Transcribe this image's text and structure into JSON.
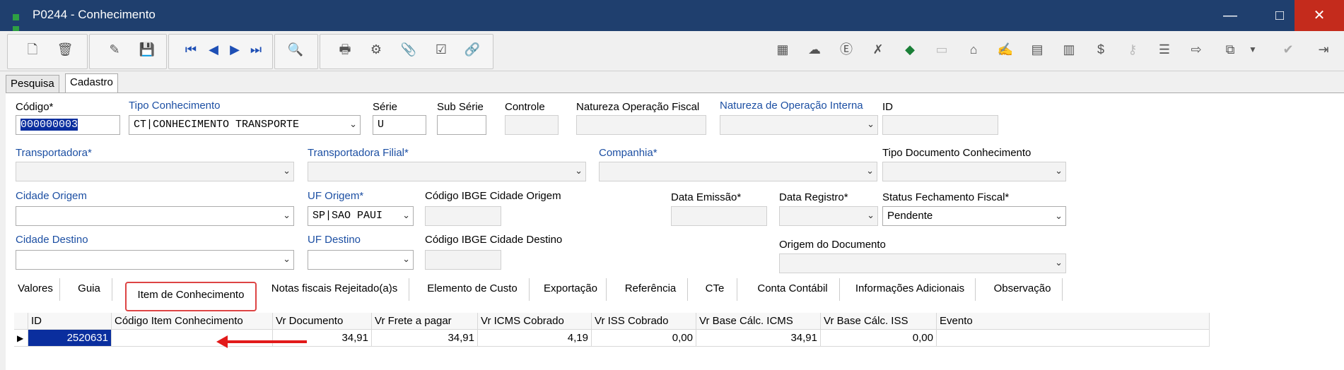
{
  "window": {
    "title": "P0244 - Conhecimento",
    "min": "—",
    "max": "□",
    "close": "✕"
  },
  "tabs_top": [
    "Pesquisa",
    "Cadastro"
  ],
  "form": {
    "codigo_label": "Código*",
    "codigo_value": "000000003",
    "tipo_label": "Tipo Conhecimento",
    "tipo_value": "CT|CONHECIMENTO TRANSPORTE",
    "serie_label": "Série",
    "serie_value": "U",
    "subserie_label": "Sub Série",
    "controle_label": "Controle",
    "nat_fiscal_label": "Natureza Operação Fiscal",
    "nat_interna_label": "Natureza de Operação Interna",
    "id_label": "ID",
    "transportadora_label": "Transportadora*",
    "transp_filial_label": "Transportadora Filial*",
    "companhia_label": "Companhia*",
    "tipo_doc_label": "Tipo Documento Conhecimento",
    "cidade_origem_label": "Cidade Origem",
    "uf_origem_label": "UF Origem*",
    "uf_origem_value": "SP|SAO PAUI",
    "ibge_origem_label": "Código IBGE Cidade Origem",
    "data_emissao_label": "Data Emissão*",
    "data_registro_label": "Data Registro*",
    "status_label": "Status Fechamento Fiscal*",
    "status_value": "Pendente",
    "cidade_destino_label": "Cidade Destino",
    "uf_destino_label": "UF Destino",
    "ibge_destino_label": "Código IBGE Cidade Destino",
    "origem_doc_label": "Origem do Documento"
  },
  "content_tabs": [
    "Valores",
    "Guia",
    "Item de Conhecimento",
    "Notas fiscais Rejeitado(a)s",
    "Elemento de Custo",
    "Exportação",
    "Referência",
    "CTe",
    "Conta Contábil",
    "Informações Adicionais",
    "Observação"
  ],
  "grid": {
    "columns": [
      "ID",
      "Código Item Conhecimento",
      "Vr Documento",
      "Vr Frete a pagar",
      "Vr ICMS Cobrado",
      "Vr ISS Cobrado",
      "Vr Base Cálc. ICMS",
      "Vr Base Cálc. ISS",
      "Evento"
    ],
    "rows": [
      [
        "2520631",
        "",
        "34,91",
        "34,91",
        "4,19",
        "0,00",
        "34,91",
        "0,00",
        ""
      ]
    ]
  },
  "colors": {
    "titlebar": "#1f3f6e",
    "close": "#c42b1c",
    "label_blue": "#1c4fa3",
    "highlight_tab": "#dd4444",
    "arrow": "#e21a1a"
  }
}
